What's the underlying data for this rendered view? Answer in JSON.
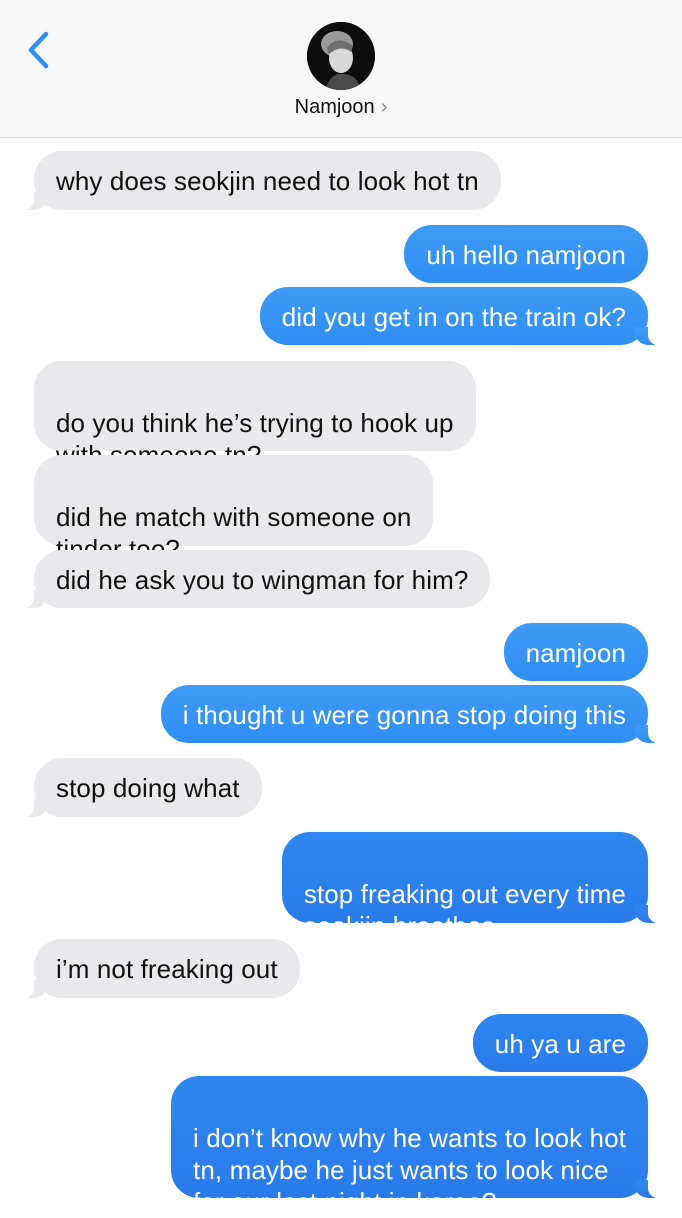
{
  "header": {
    "contact_name": "Namjoon",
    "chevron": "›",
    "back_icon": "chevron-left-icon",
    "accent_color": "#2f8ef2"
  },
  "messages": [
    {
      "side": "in",
      "text": "why does seokjin need to look hot tn"
    },
    {
      "side": "out",
      "text": "uh hello namjoon"
    },
    {
      "side": "out",
      "text": "did you get in on the train ok?"
    },
    {
      "side": "in",
      "text": "do you think he’s trying to hook up\nwith someone tn?"
    },
    {
      "side": "in",
      "text": "did he match with someone on\ntinder too?"
    },
    {
      "side": "in",
      "text": "did he ask you to wingman for him?"
    },
    {
      "side": "out",
      "text": "namjoon"
    },
    {
      "side": "out",
      "text": "i thought u were gonna stop doing this"
    },
    {
      "side": "in",
      "text": "stop doing what"
    },
    {
      "side": "out",
      "text": "stop freaking out every time\nseokjin breathes"
    },
    {
      "side": "in",
      "text": "i’m not freaking out"
    },
    {
      "side": "out",
      "text": "uh ya u are"
    },
    {
      "side": "out",
      "text": "i don’t know why he wants to look hot\ntn, maybe he just wants to look nice\nfor our last night in korea?"
    }
  ],
  "colors": {
    "incoming_bubble": "#e9e9eb",
    "outgoing_bubble": "#2f8ef2"
  }
}
